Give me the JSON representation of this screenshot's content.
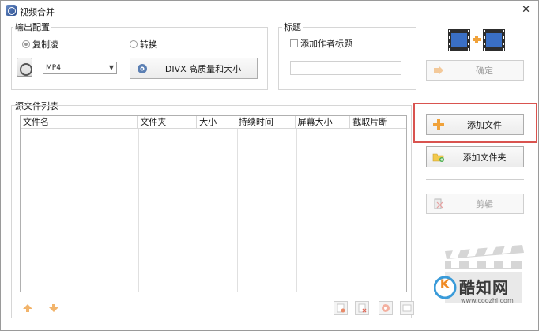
{
  "window": {
    "title": "视频合并",
    "close_glyph": "✕"
  },
  "output": {
    "group_label": "输出配置",
    "copy_mode_label": "复制凌",
    "convert_label": "转换",
    "format_value": "MP4",
    "profile_label": "DIVX 高质量和大小"
  },
  "title_group": {
    "group_label": "标题",
    "add_author_label": "添加作者标题"
  },
  "actions": {
    "confirm_label": "确定",
    "add_file_label": "添加文件",
    "add_folder_label": "添加文件夹",
    "cut_label": "剪辑"
  },
  "source_list": {
    "group_label": "源文件列表",
    "columns": [
      "文件名",
      "文件夹",
      "大小",
      "持续时间",
      "屏幕大小",
      "截取片断"
    ]
  },
  "watermark": {
    "brand_name": "酷知网",
    "brand_url": "www.coozhi.com",
    "logo_letter": "K"
  },
  "colors": {
    "highlight": "#d9534f",
    "film_blue": "#3a6fc4",
    "plus_orange": "#f0a23a"
  },
  "icons": {
    "up": "up-arrow-icon",
    "down": "down-arrow-icon"
  }
}
